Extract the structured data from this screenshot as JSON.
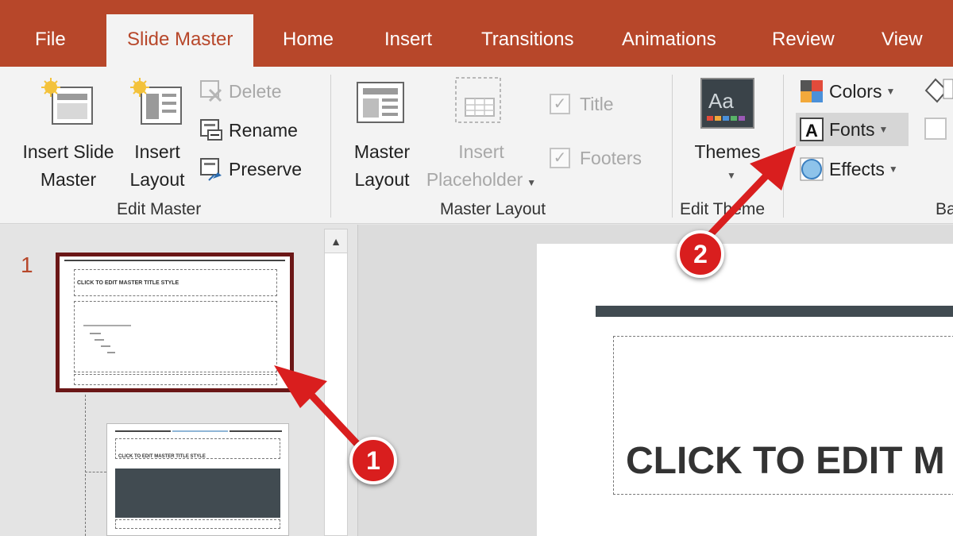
{
  "tabs": [
    {
      "label": "File"
    },
    {
      "label": "Slide Master",
      "active": true
    },
    {
      "label": "Home"
    },
    {
      "label": "Insert"
    },
    {
      "label": "Transitions"
    },
    {
      "label": "Animations"
    },
    {
      "label": "Review"
    },
    {
      "label": "View"
    }
  ],
  "edit_master": {
    "insert_slide_master": {
      "line1": "Insert Slide",
      "line2": "Master"
    },
    "insert_layout": {
      "line1": "Insert",
      "line2": "Layout"
    },
    "delete": "Delete",
    "rename": "Rename",
    "preserve": "Preserve",
    "group_label": "Edit Master"
  },
  "master_layout": {
    "master_layout_btn": {
      "line1": "Master",
      "line2": "Layout"
    },
    "insert_placeholder": {
      "line1": "Insert",
      "line2": "Placeholder"
    },
    "title_check": "Title",
    "footers_check": "Footers",
    "group_label": "Master Layout"
  },
  "edit_theme": {
    "themes": "Themes",
    "group_label": "Edit Theme"
  },
  "background": {
    "colors": "Colors",
    "fonts": "Fonts",
    "effects": "Effects",
    "group_label": "Ba"
  },
  "thumbnails": {
    "slide_number": "1",
    "thumb_title": "CLICK TO EDIT MASTER TITLE STYLE"
  },
  "slide": {
    "title": "CLICK TO EDIT M"
  },
  "annotations": {
    "badge1": "1",
    "badge2": "2"
  },
  "colors": {
    "accent": "#b7472a",
    "ribbon_bg": "#f3f3f3",
    "arrow": "#d91e1e",
    "selected_thumb_border": "#6b1717",
    "slide_bar": "#414b51"
  }
}
